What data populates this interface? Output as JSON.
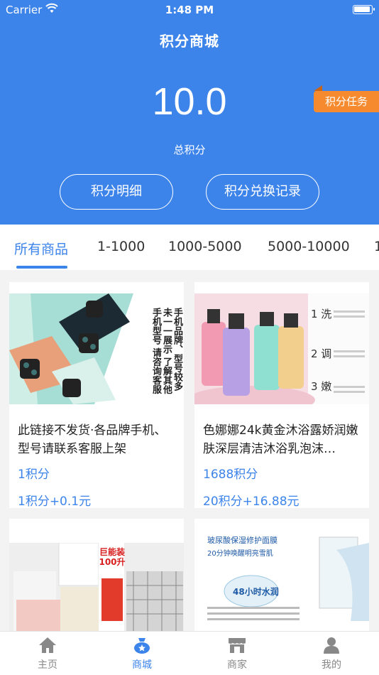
{
  "status_bar": {
    "carrier": "Carrier",
    "time": "1:48 PM"
  },
  "header": {
    "title": "积分商城",
    "points_value": "10.0",
    "points_label": "总积分",
    "task_badge": "积分任务",
    "detail_button": "积分明细",
    "exchange_record_button": "积分兑换记录"
  },
  "tabs": [
    {
      "label": "所有商品",
      "active": true
    },
    {
      "label": "1-1000",
      "active": false
    },
    {
      "label": "1000-5000",
      "active": false
    },
    {
      "label": "5000-10000",
      "active": false
    },
    {
      "label": "1",
      "active": false
    }
  ],
  "products": [
    {
      "name": "此链接不发货·各品牌手机、型号请联系客服上架",
      "points": "1积分",
      "price": "1积分+0.1元",
      "image_text": "手机品牌、型号较多 未一一展示 了解其他手机型号 请咨询客服"
    },
    {
      "name": "色娜娜24k黄金沐浴露娇润嫩肤深层清洁沐浴乳泡沫…",
      "points": "1688积分",
      "price": "20积分+16.88元",
      "image_text": [
        "1 洗",
        "2 调",
        "3 嫩"
      ]
    },
    {
      "name": "",
      "points": "",
      "price": "",
      "image_text": [
        "巨能装",
        "100升"
      ]
    },
    {
      "name": "",
      "points": "",
      "price": "",
      "image_text": [
        "玻尿酸保湿修护面膜",
        "20分钟唤醒明亮雪肌",
        "48小时水润"
      ]
    }
  ],
  "tabbar": [
    {
      "label": "主页",
      "icon": "home-icon",
      "active": false
    },
    {
      "label": "商城",
      "icon": "mall-bag-icon",
      "active": true
    },
    {
      "label": "商家",
      "icon": "shop-icon",
      "active": false
    },
    {
      "label": "我的",
      "icon": "user-icon",
      "active": false
    }
  ],
  "colors": {
    "primary": "#3d84ea",
    "badge": "#f58b2e",
    "background": "#f3f3f3"
  }
}
